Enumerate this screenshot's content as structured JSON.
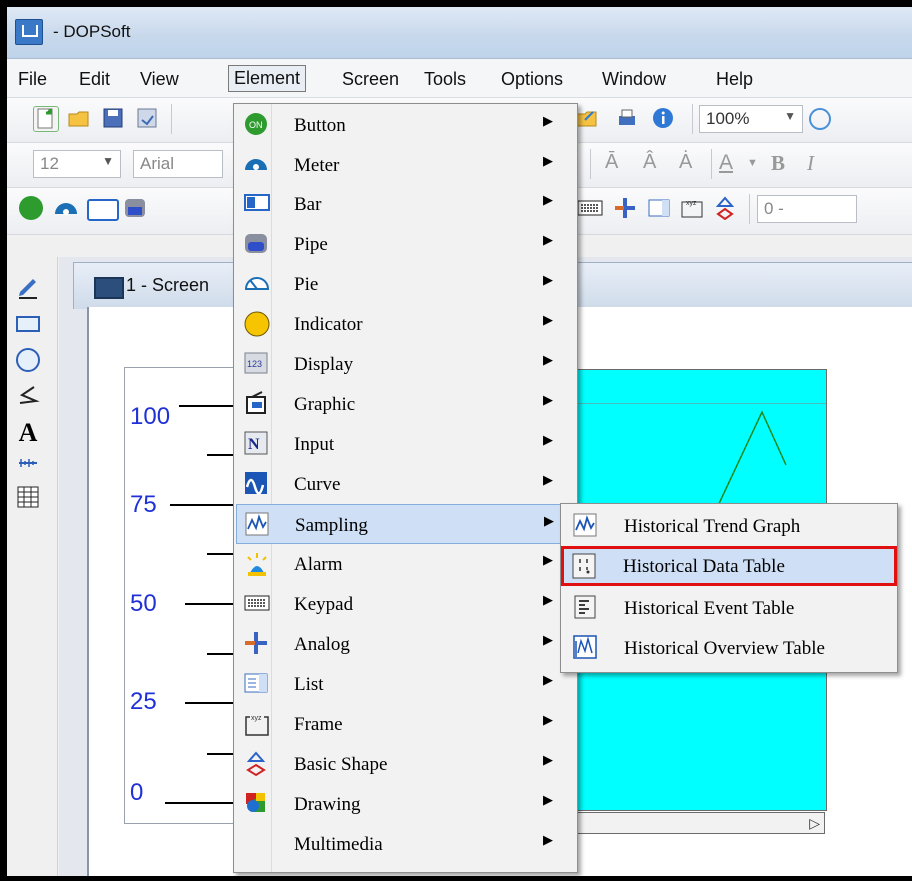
{
  "window": {
    "title": "- DOPSoft"
  },
  "menubar": {
    "items": [
      "File",
      "Edit",
      "View",
      "Element",
      "Screen",
      "Tools",
      "Options",
      "Window",
      "Help"
    ],
    "active": "Element"
  },
  "toolbar": {
    "zoom": "100%",
    "font_size": "12",
    "font_name": "Arial",
    "numeric_field": "0 -"
  },
  "screen_tab": {
    "title": "1 - Screen"
  },
  "meter_scale": [
    "100",
    "75",
    "50",
    "25",
    "0"
  ],
  "element_menu": {
    "items": [
      {
        "label": "Button",
        "icon": "button-on-icon"
      },
      {
        "label": "Meter",
        "icon": "meter-icon"
      },
      {
        "label": "Bar",
        "icon": "bar-icon"
      },
      {
        "label": "Pipe",
        "icon": "pipe-icon"
      },
      {
        "label": "Pie",
        "icon": "pie-icon"
      },
      {
        "label": "Indicator",
        "icon": "indicator-icon"
      },
      {
        "label": "Display",
        "icon": "display-123-icon"
      },
      {
        "label": "Graphic",
        "icon": "graphic-icon"
      },
      {
        "label": "Input",
        "icon": "input-n-icon"
      },
      {
        "label": "Curve",
        "icon": "curve-icon"
      },
      {
        "label": "Sampling",
        "icon": "sampling-icon"
      },
      {
        "label": "Alarm",
        "icon": "alarm-icon"
      },
      {
        "label": "Keypad",
        "icon": "keypad-icon"
      },
      {
        "label": "Analog",
        "icon": "analog-icon"
      },
      {
        "label": "List",
        "icon": "list-icon"
      },
      {
        "label": "Frame",
        "icon": "frame-icon"
      },
      {
        "label": "Basic Shape",
        "icon": "basic-shape-icon"
      },
      {
        "label": "Drawing",
        "icon": "drawing-icon"
      },
      {
        "label": "Multimedia",
        "icon": ""
      }
    ],
    "highlighted": "Sampling"
  },
  "sampling_submenu": {
    "items": [
      {
        "label": "Historical Trend Graph",
        "icon": "trend-graph-icon"
      },
      {
        "label": "Historical Data Table",
        "icon": "data-table-icon"
      },
      {
        "label": "Historical Event Table",
        "icon": "event-table-icon"
      },
      {
        "label": "Historical Overview Table",
        "icon": "overview-table-icon"
      }
    ],
    "highlighted": "Historical Data Table",
    "highlight_border_color": "#e01010"
  },
  "colors": {
    "meter_scale": "#1f31d6",
    "cyan_panel": "#00ffff",
    "menu_highlight": "#cfe0f6"
  }
}
